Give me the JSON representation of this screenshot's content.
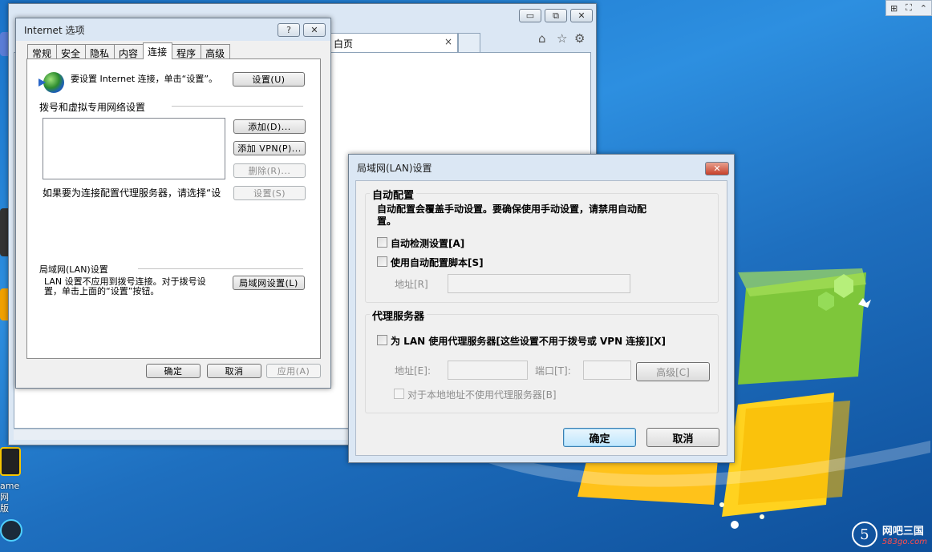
{
  "ie_window": {
    "tab_title": "白页",
    "tab_close": "×",
    "caption_buttons": [
      "▭",
      "⧉",
      "✕"
    ]
  },
  "options_dialog": {
    "title": "Internet 选项",
    "help_button": "?",
    "close_button": "✕",
    "tabs": [
      "常规",
      "安全",
      "隐私",
      "内容",
      "连接",
      "程序",
      "高级"
    ],
    "active_tab": "连接",
    "setup_text": "要设置 Internet 连接，单击“设置”。",
    "setup_button": "设置(U)",
    "dialup_section": "拨号和虚拟专用网络设置",
    "add_button": "添加(D)...",
    "add_vpn_button": "添加 VPN(P)...",
    "remove_button": "删除(R)...",
    "proxy_hint": "如果要为连接配置代理服务器，请选择“设",
    "settings_button": "设置(S)",
    "lan_section": "局域网(LAN)设置",
    "lan_text_line1": "LAN 设置不应用到拨号连接。对于拨号设",
    "lan_text_line2": "置，单击上面的“设置”按钮。",
    "lan_button": "局域网设置(L)",
    "ok_button": "确定",
    "cancel_button": "取消",
    "apply_button": "应用(A)"
  },
  "lan_dialog": {
    "title": "局域网(LAN)设置",
    "close_button": "✕",
    "auto_config": {
      "group_title": "自动配置",
      "description_line1": "自动配置会覆盖手动设置。要确保使用手动设置，请禁用自动配",
      "description_line2": "置。",
      "auto_detect_label": "自动检测设置[A]",
      "auto_detect_checked": false,
      "use_script_label": "使用自动配置脚本[S]",
      "use_script_checked": false,
      "address_label": "地址[R]",
      "address_value": ""
    },
    "proxy": {
      "group_title": "代理服务器",
      "use_proxy_label": "为 LAN 使用代理服务器[这些设置不用于拨号或 VPN 连接][X]",
      "use_proxy_checked": false,
      "address_label": "地址[E]:",
      "address_value": "",
      "port_label": "端口[T]:",
      "port_value": "",
      "advanced_button": "高级[C]",
      "bypass_label": "对于本地地址不使用代理服务器[B]",
      "bypass_checked": false
    },
    "ok_button": "确定",
    "cancel_button": "取消"
  },
  "desktop": {
    "icon_label_line1": "ame网",
    "icon_label_line2": "版",
    "top_right_icons": [
      "⊞",
      "⛶",
      "⌃"
    ]
  },
  "watermark": {
    "logo_glyph": "5",
    "name": "网吧三国",
    "url": "583go.com"
  }
}
